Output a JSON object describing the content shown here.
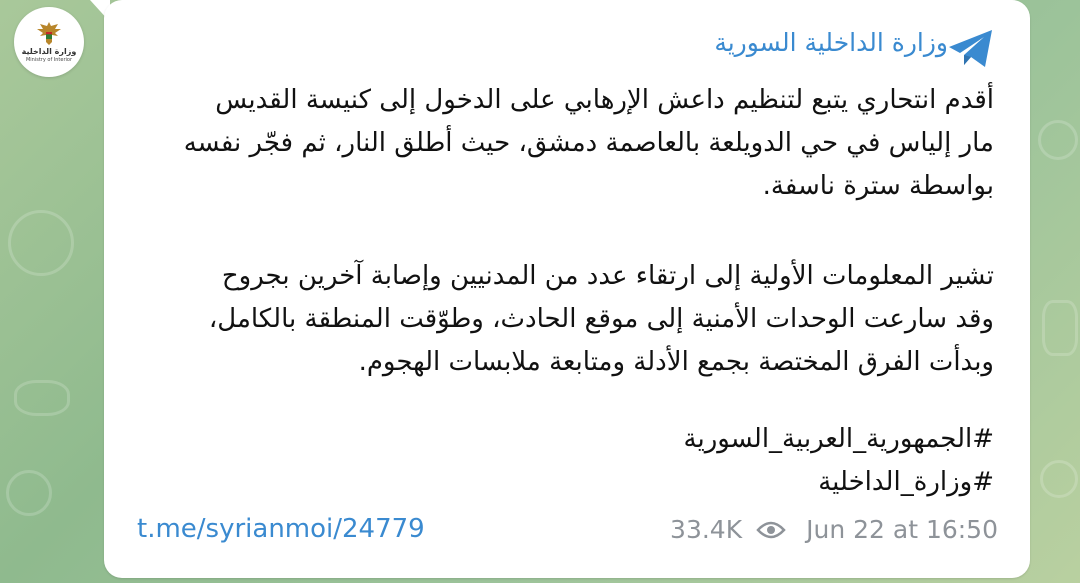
{
  "channel": {
    "name": "وزارة الداخلية السورية",
    "logo_text_ar": "وزارة الداخلية",
    "logo_text_en": "Ministry of Interior",
    "avatar_icon": "syrian-eagle-emblem",
    "platform_icon": "telegram-icon"
  },
  "message": {
    "paragraph1_lines": [
      "أقدم انتحاري يتبع لتنظيم داعش الإرهابي على الدخول إلى كنيسة القديس",
      "مار إلياس في حي الدويلعة بالعاصمة دمشق، حيث أطلق النار، ثم فجّر نفسه",
      "بواسطة سترة ناسفة."
    ],
    "paragraph2_lines": [
      "تشير المعلومات الأولية إلى ارتقاء عدد من المدنيين وإصابة آخرين بجروح",
      "وقد سارعت الوحدات الأمنية إلى موقع الحادث، وطوّقت المنطقة بالكامل،",
      "وبدأت الفرق المختصة بجمع الأدلة ومتابعة ملابسات الهجوم."
    ],
    "hashtags": [
      "#الجمهورية_العربية_السورية",
      "#وزارة_الداخلية"
    ]
  },
  "footer": {
    "link": "t.me/syrianmoi/24779",
    "views": "33.4K",
    "views_icon": "eye-icon",
    "timestamp": "Jun 22 at 16:50"
  },
  "colors": {
    "accent": "#3a8ad0",
    "bubble": "#ffffff",
    "meta_text": "#8e9399",
    "background": "#9cc39a"
  }
}
